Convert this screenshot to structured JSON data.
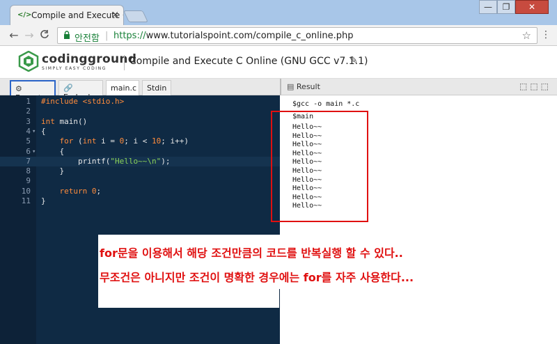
{
  "browser": {
    "tab_title": "Compile and Execute C",
    "tab_close": "×",
    "favicon": "</>",
    "win_min": "—",
    "win_max": "❐",
    "win_close": "✕",
    "back": "←",
    "forward": "→",
    "reload": "C",
    "secure_label": "안전함",
    "url_proto": "https://",
    "url_rest": "www.tutorialspoint.com/compile_c_online.php",
    "star": "☆",
    "menu": "⋮"
  },
  "site": {
    "logo_name": "codingground",
    "logo_tagline": "SIMPLY EASY CODING",
    "page_title": "Compile and Execute C Online (GNU GCC v7.1.1)",
    "edit_icon": "✎"
  },
  "editor_tabs": {
    "execute": "Execute",
    "embed": "Embed",
    "main": "main.c",
    "stdin": "Stdin"
  },
  "result": {
    "label": "Result",
    "icons": "⬚⬚⬚"
  },
  "code_lines": [
    {
      "n": "1",
      "text": "#include <stdio.h>"
    },
    {
      "n": "2",
      "text": ""
    },
    {
      "n": "3",
      "text": "int main()"
    },
    {
      "n": "4",
      "text": "{"
    },
    {
      "n": "5",
      "text": "    for (int i = 0; i < 10; i++)"
    },
    {
      "n": "6",
      "text": "    {"
    },
    {
      "n": "7",
      "text": "        printf(\"Hello~~\\n\");"
    },
    {
      "n": "8",
      "text": "    }"
    },
    {
      "n": "9",
      "text": ""
    },
    {
      "n": "10",
      "text": "    return 0;"
    },
    {
      "n": "11",
      "text": "}"
    }
  ],
  "output": {
    "command": "$gcc -o main *.c",
    "prompt": "$main",
    "lines": [
      "Hello~~",
      "Hello~~",
      "Hello~~",
      "Hello~~",
      "Hello~~",
      "Hello~~",
      "Hello~~",
      "Hello~~",
      "Hello~~",
      "Hello~~"
    ]
  },
  "annotation": {
    "line1": "for문을 이용해서 해당 조건만큼의 코드를 반복실행 할 수 있다..",
    "line2": "무조건은 아니지만 조건이 명확한 경우에는 for를 자주 사용한다..."
  },
  "colors": {
    "editor_bg": "#0f2a44",
    "annotation_red": "#e01010",
    "keyword_orange": "#ff8c3c",
    "string_green": "#8cd35a"
  }
}
